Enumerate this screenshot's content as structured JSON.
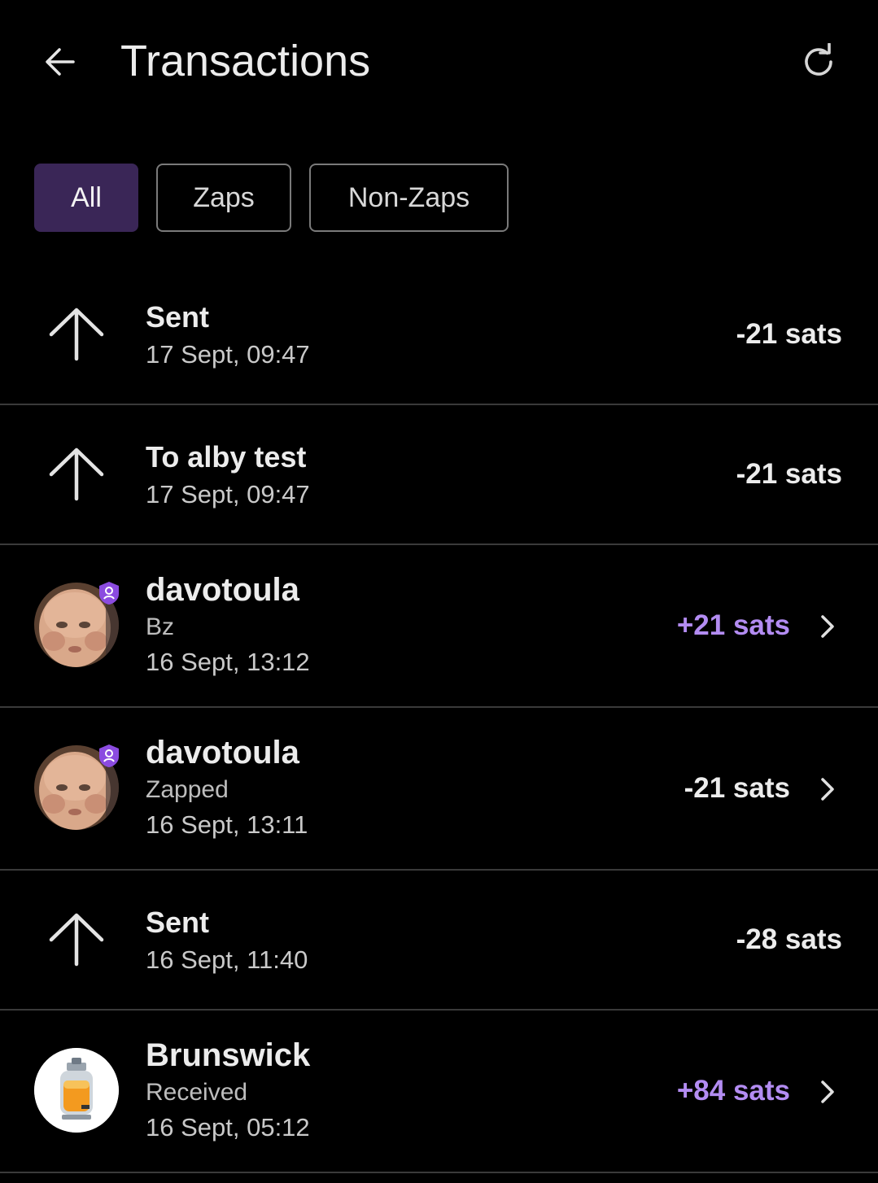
{
  "header": {
    "title": "Transactions",
    "back_icon": "arrow-left-icon",
    "refresh_icon": "refresh-icon"
  },
  "filters": [
    {
      "label": "All",
      "active": true
    },
    {
      "label": "Zaps",
      "active": false
    },
    {
      "label": "Non-Zaps",
      "active": false
    }
  ],
  "colors": {
    "background": "#000000",
    "active_chip": "#3a2657",
    "positive_amount": "#b38cf2",
    "badge": "#8b4be0",
    "divider": "#3a3a3a"
  },
  "transactions": [
    {
      "icon": "arrow-up-icon",
      "name": "Sent",
      "subtitle": "",
      "date": "17 Sept, 09:47",
      "amount": "-21 sats",
      "positive": false,
      "has_chevron": false
    },
    {
      "icon": "arrow-up-icon",
      "name": "To alby test",
      "subtitle": "",
      "date": "17 Sept, 09:47",
      "amount": "-21 sats",
      "positive": false,
      "has_chevron": false
    },
    {
      "icon": "avatar",
      "name": "davotoula",
      "subtitle": "Bz",
      "date": "16 Sept, 13:12",
      "amount": "+21 sats",
      "positive": true,
      "has_chevron": true
    },
    {
      "icon": "avatar",
      "name": "davotoula",
      "subtitle": "Zapped",
      "date": "16 Sept, 13:11",
      "amount": "-21 sats",
      "positive": false,
      "has_chevron": true
    },
    {
      "icon": "arrow-up-icon",
      "name": "Sent",
      "subtitle": "",
      "date": "16 Sept, 11:40",
      "amount": "-28 sats",
      "positive": false,
      "has_chevron": false
    },
    {
      "icon": "avatar",
      "name": "Brunswick",
      "subtitle": "Received",
      "date": "16 Sept, 05:12",
      "amount": "+84 sats",
      "positive": true,
      "has_chevron": true
    }
  ]
}
